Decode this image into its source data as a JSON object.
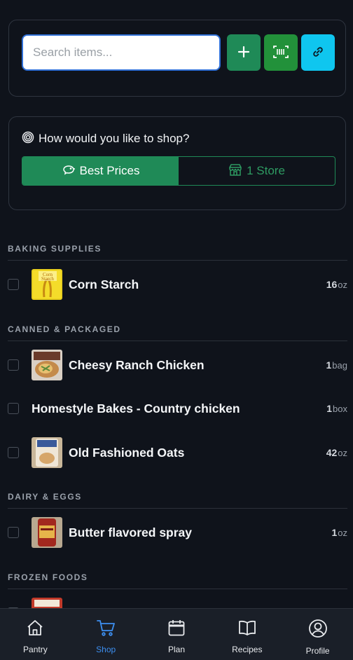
{
  "search": {
    "placeholder": "Search items...",
    "value": ""
  },
  "actions": {
    "add_icon": "plus-icon",
    "scan_icon": "barcode-scan-icon",
    "link_icon": "link-icon"
  },
  "shop_mode": {
    "title": "How would you like to shop?",
    "title_icon": "target-icon",
    "options": [
      {
        "label": "Best Prices",
        "icon": "piggy-bank-icon",
        "active": true
      },
      {
        "label": "1 Store",
        "icon": "store-icon",
        "active": false
      }
    ]
  },
  "sections": [
    {
      "title": "BAKING SUPPLIES",
      "items": [
        {
          "name": "Corn Starch",
          "qty": "16",
          "unit": "oz",
          "has_image": true
        }
      ]
    },
    {
      "title": "CANNED & PACKAGED",
      "items": [
        {
          "name": "Cheesy Ranch Chicken",
          "qty": "1",
          "unit": "bag",
          "has_image": true
        },
        {
          "name": "Homestyle Bakes - Country chicken",
          "qty": "1",
          "unit": "box",
          "has_image": false
        },
        {
          "name": "Old Fashioned Oats",
          "qty": "42",
          "unit": "oz",
          "has_image": true
        }
      ]
    },
    {
      "title": "DAIRY & EGGS",
      "items": [
        {
          "name": "Butter flavored spray",
          "qty": "1",
          "unit": "oz",
          "has_image": true
        }
      ]
    },
    {
      "title": "FROZEN FOODS",
      "items": []
    }
  ],
  "nav": [
    {
      "label": "Pantry",
      "icon": "home-icon",
      "active": false
    },
    {
      "label": "Shop",
      "icon": "cart-icon",
      "active": true
    },
    {
      "label": "Plan",
      "icon": "calendar-icon",
      "active": false
    },
    {
      "label": "Recipes",
      "icon": "book-icon",
      "active": false
    },
    {
      "label": "Profile",
      "icon": "user-circle-icon",
      "active": false
    }
  ],
  "colors": {
    "background": "#0f131b",
    "accent_green": "#1f8a57",
    "scan_green": "#22913a",
    "link_cyan": "#0fc6ef",
    "nav_active": "#3d8ff0"
  }
}
